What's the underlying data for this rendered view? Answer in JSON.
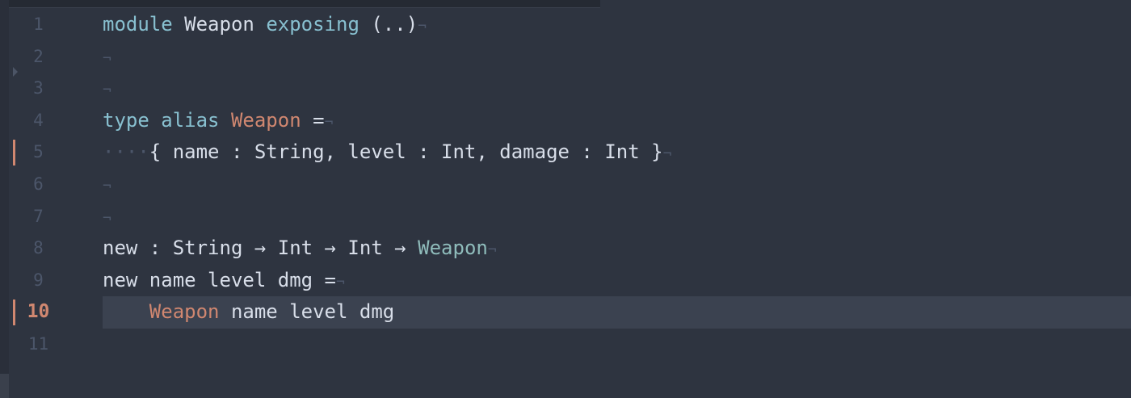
{
  "editor": {
    "lines": [
      {
        "num": "1",
        "tokens": [
          {
            "t": "module",
            "c": "kw"
          },
          {
            "t": " ",
            "c": "plain"
          },
          {
            "t": "Weapon",
            "c": "cap"
          },
          {
            "t": " ",
            "c": "plain"
          },
          {
            "t": "exposing",
            "c": "kw"
          },
          {
            "t": " ",
            "c": "plain"
          },
          {
            "t": "(..)",
            "c": "plain"
          },
          {
            "t": "¬",
            "c": "eol"
          }
        ]
      },
      {
        "num": "2",
        "tokens": [
          {
            "t": "¬",
            "c": "eol"
          }
        ]
      },
      {
        "num": "3",
        "tokens": [
          {
            "t": "¬",
            "c": "eol"
          }
        ]
      },
      {
        "num": "4",
        "tokens": [
          {
            "t": "type",
            "c": "kw"
          },
          {
            "t": " ",
            "c": "plain"
          },
          {
            "t": "alias",
            "c": "kw"
          },
          {
            "t": " ",
            "c": "plain"
          },
          {
            "t": "Weapon",
            "c": "type"
          },
          {
            "t": " ",
            "c": "plain"
          },
          {
            "t": "=",
            "c": "plain"
          },
          {
            "t": "¬",
            "c": "eol"
          }
        ]
      },
      {
        "num": "5",
        "changed": true,
        "tokens": [
          {
            "t": "····",
            "c": "ws"
          },
          {
            "t": "{ name : String, level : Int, damage : Int }",
            "c": "plain"
          },
          {
            "t": "¬",
            "c": "eol"
          }
        ]
      },
      {
        "num": "6",
        "tokens": [
          {
            "t": "¬",
            "c": "eol"
          }
        ]
      },
      {
        "num": "7",
        "tokens": [
          {
            "t": "¬",
            "c": "eol"
          }
        ]
      },
      {
        "num": "8",
        "tokens": [
          {
            "t": "new : String → Int → Int → ",
            "c": "plain"
          },
          {
            "t": "Weapon",
            "c": "teal"
          },
          {
            "t": "¬",
            "c": "eol"
          }
        ]
      },
      {
        "num": "9",
        "tokens": [
          {
            "t": "new name level dmg =",
            "c": "plain"
          },
          {
            "t": "¬",
            "c": "eol"
          }
        ]
      },
      {
        "num": "10",
        "current": true,
        "changed": true,
        "tokens": [
          {
            "t": "    ",
            "c": "plain"
          },
          {
            "t": "Weapon",
            "c": "type"
          },
          {
            "t": " name level dmg",
            "c": "plain"
          }
        ]
      },
      {
        "num": "11",
        "tokens": []
      }
    ]
  }
}
